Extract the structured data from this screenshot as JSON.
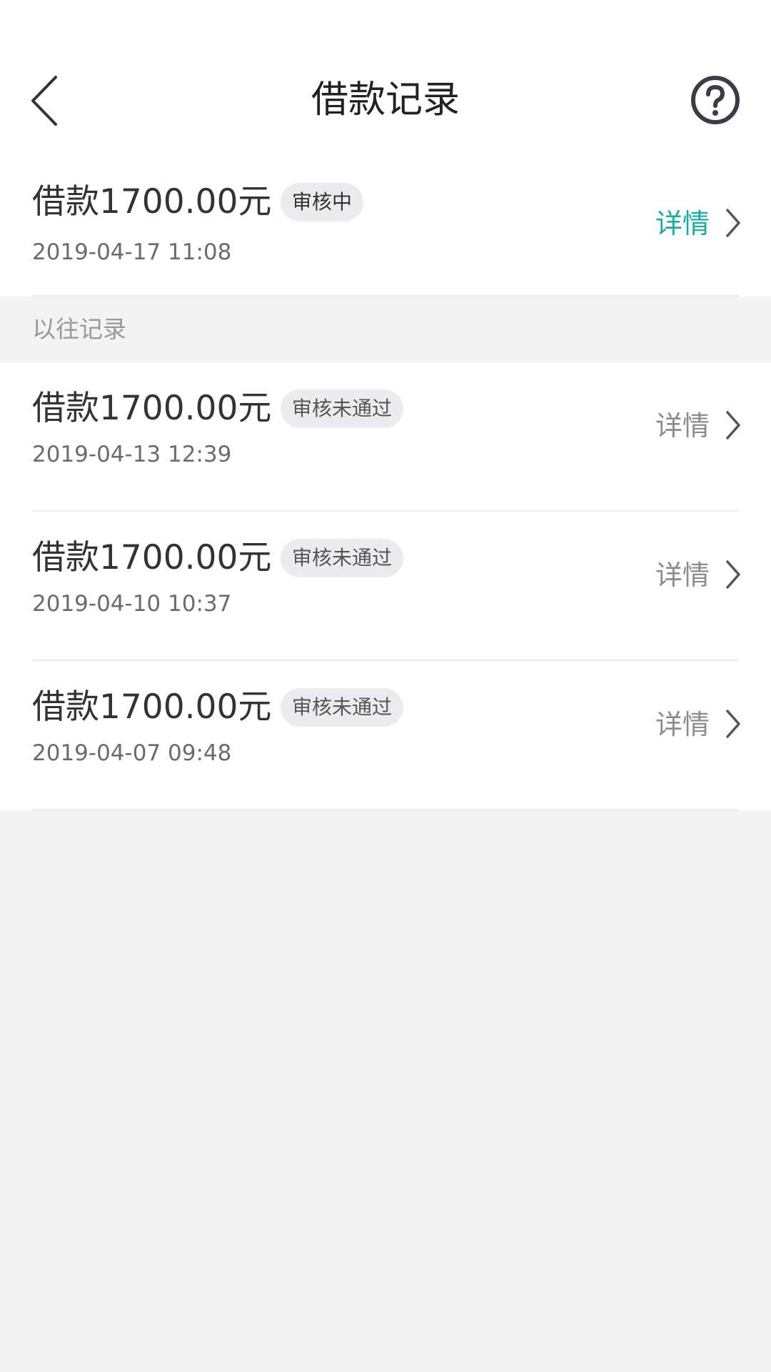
{
  "header": {
    "back_icon": "chevron-left-icon",
    "title": "借款记录",
    "help_icon": "question-circle-icon"
  },
  "colors": {
    "accent": "#1aaca4",
    "badge_bg": "#ececef",
    "page_bg": "#f3f3f3",
    "detail_gray": "#8c8c8c"
  },
  "current_record": {
    "amount": "借款1700.00元",
    "status": "审核中",
    "date": "2019-04-17 11:08",
    "detail_label": "详情"
  },
  "past_section": {
    "label": "以往记录"
  },
  "past_records": [
    {
      "amount": "借款1700.00元",
      "status": "审核未通过",
      "date": "2019-04-13 12:39",
      "detail_label": "详情"
    },
    {
      "amount": "借款1700.00元",
      "status": "审核未通过",
      "date": "2019-04-10 10:37",
      "detail_label": "详情"
    },
    {
      "amount": "借款1700.00元",
      "status": "审核未通过",
      "date": "2019-04-07 09:48",
      "detail_label": "详情"
    }
  ]
}
